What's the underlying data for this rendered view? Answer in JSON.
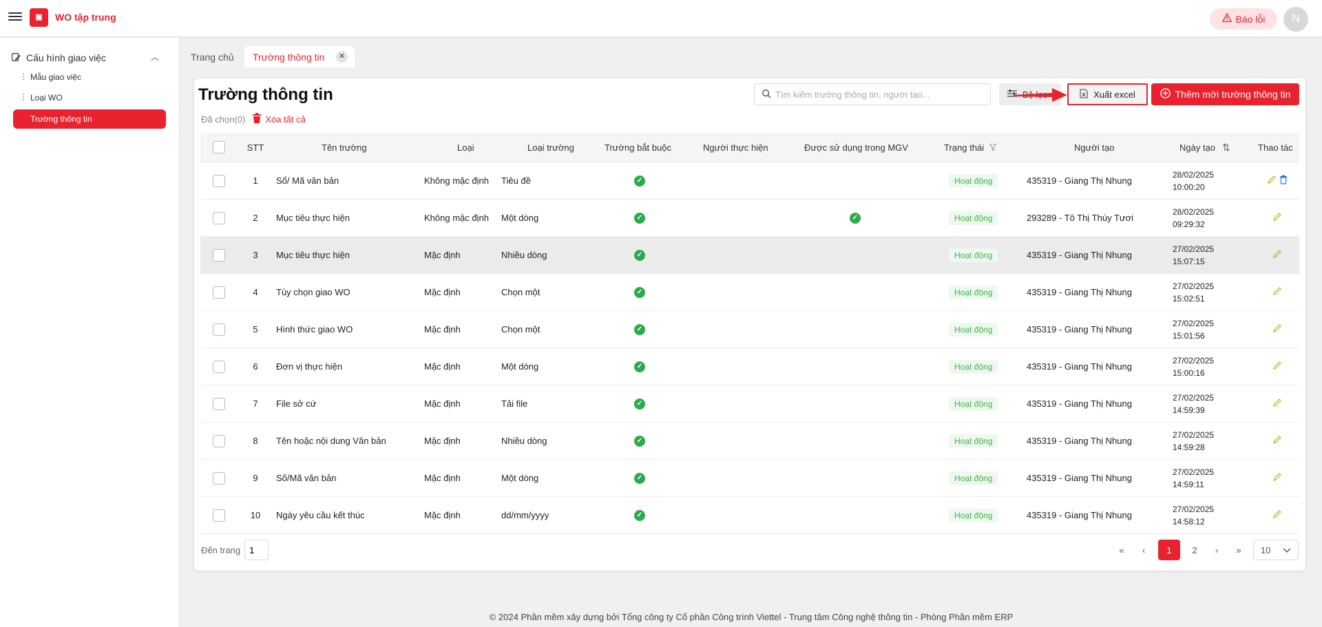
{
  "header": {
    "app_title": "WO tập trung",
    "report_label": "Báo lỗi",
    "avatar_letter": "N"
  },
  "sidebar": {
    "group_label": "Cấu hình giao việc",
    "items": [
      {
        "label": "Mẫu giao việc"
      },
      {
        "label": "Loại WO"
      },
      {
        "label": "Trường thông tin"
      }
    ]
  },
  "tabs": [
    {
      "label": "Trang chủ"
    },
    {
      "label": "Trường thông tin"
    }
  ],
  "page": {
    "title": "Trường thông tin",
    "selected_label": "Đã chọn(0)",
    "delete_all_label": "Xóa tất cả",
    "search_placeholder": "Tìm kiếm trường thông tin, người tạo...",
    "filter_label": "Bộ lọc",
    "export_label": "Xuất excel",
    "add_label": "Thêm mới trường thông tin"
  },
  "table": {
    "headers": [
      "STT",
      "Tên trường",
      "Loại",
      "Loại trường",
      "Trường bắt buộc",
      "Người thực hiện",
      "Được sử dụng trong MGV",
      "Trạng thái",
      "Người tạo",
      "Ngày tạo",
      "Thao tác"
    ],
    "rows": [
      {
        "stt": "1",
        "name": "Sổ/ Mã văn bản",
        "type": "Không mặc định",
        "field_type": "Tiêu đề",
        "required": true,
        "mgv": false,
        "status": "Hoạt động",
        "creator": "435319 - Giang Thị Nhung",
        "date": "28/02/2025",
        "time": "10:00:20",
        "deletable": true
      },
      {
        "stt": "2",
        "name": "Mục tiêu thực hiện",
        "type": "Không mặc định",
        "field_type": "Một dòng",
        "required": true,
        "mgv": true,
        "status": "Hoạt động",
        "creator": "293289 - Tô Thị Thúy Tươi",
        "date": "28/02/2025",
        "time": "09:29:32",
        "deletable": false
      },
      {
        "stt": "3",
        "name": "Mục tiêu thực hiện",
        "type": "Mặc định",
        "field_type": "Nhiều dòng",
        "required": true,
        "mgv": false,
        "status": "Hoạt động",
        "creator": "435319 - Giang Thị Nhung",
        "date": "27/02/2025",
        "time": "15:07:15",
        "deletable": false
      },
      {
        "stt": "4",
        "name": "Tùy chọn giao WO",
        "type": "Mặc định",
        "field_type": "Chọn một",
        "required": true,
        "mgv": false,
        "status": "Hoạt động",
        "creator": "435319 - Giang Thị Nhung",
        "date": "27/02/2025",
        "time": "15:02:51",
        "deletable": false
      },
      {
        "stt": "5",
        "name": "Hình thức giao WO",
        "type": "Mặc định",
        "field_type": "Chọn một",
        "required": true,
        "mgv": false,
        "status": "Hoạt động",
        "creator": "435319 - Giang Thị Nhung",
        "date": "27/02/2025",
        "time": "15:01:56",
        "deletable": false
      },
      {
        "stt": "6",
        "name": "Đơn vị thực hiện",
        "type": "Mặc định",
        "field_type": "Một dòng",
        "required": true,
        "mgv": false,
        "status": "Hoạt động",
        "creator": "435319 - Giang Thị Nhung",
        "date": "27/02/2025",
        "time": "15:00:16",
        "deletable": false
      },
      {
        "stt": "7",
        "name": "File sở cứ",
        "type": "Mặc định",
        "field_type": "Tải file",
        "required": true,
        "mgv": false,
        "status": "Hoạt động",
        "creator": "435319 - Giang Thị Nhung",
        "date": "27/02/2025",
        "time": "14:59:39",
        "deletable": false
      },
      {
        "stt": "8",
        "name": "Tên hoặc nội dung Văn bản",
        "type": "Mặc định",
        "field_type": "Nhiều dòng",
        "required": true,
        "mgv": false,
        "status": "Hoạt động",
        "creator": "435319 - Giang Thị Nhung",
        "date": "27/02/2025",
        "time": "14:59:28",
        "deletable": false
      },
      {
        "stt": "9",
        "name": "Số/Mã văn bản",
        "type": "Mặc định",
        "field_type": "Một dòng",
        "required": true,
        "mgv": false,
        "status": "Hoạt động",
        "creator": "435319 - Giang Thị Nhung",
        "date": "27/02/2025",
        "time": "14:59:11",
        "deletable": false
      },
      {
        "stt": "10",
        "name": "Ngày yêu cầu kết thúc",
        "type": "Mặc định",
        "field_type": "dd/mm/yyyy",
        "required": true,
        "mgv": false,
        "status": "Hoạt động",
        "creator": "435319 - Giang Thị Nhung",
        "date": "27/02/2025",
        "time": "14:58:12",
        "deletable": false
      }
    ]
  },
  "pagination": {
    "goto_label": "Đến trang",
    "goto_value": "1",
    "pages": [
      "1",
      "2"
    ],
    "page_size": "10"
  },
  "footer": {
    "text": "© 2024 Phần mềm xây dựng bởi Tổng công ty Cổ phần Công trình Viettel - Trung tâm Công nghệ thông tin - Phòng Phần mềm ERP"
  },
  "colors": {
    "accent": "#e8232f",
    "success": "#2daa4b"
  }
}
